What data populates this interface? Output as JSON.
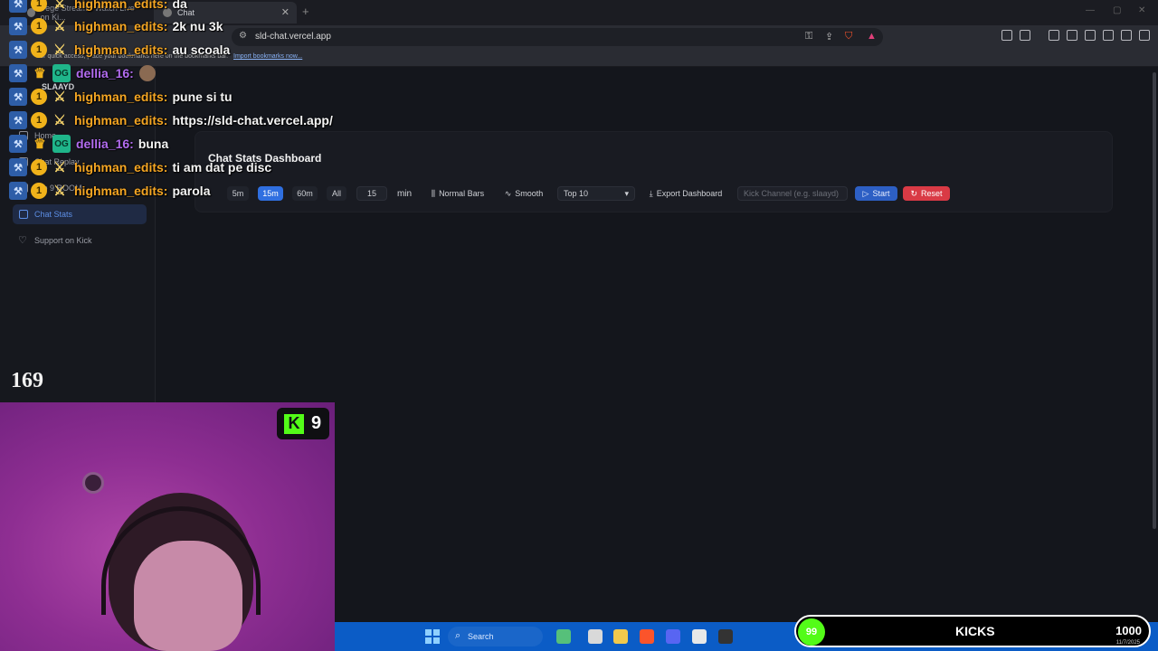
{
  "browser": {
    "tabs": [
      {
        "label": "Vege Stream - Watch Live on Ki..."
      },
      {
        "label": "Chat"
      }
    ],
    "url": "sld-chat.vercel.app",
    "bookmarks_prompt": "For quick access, place your bookmarks here on the bookmarks bar.",
    "bookmarks_link": "Import bookmarks now..."
  },
  "sidebar": {
    "brand": "SLAAYD",
    "items": [
      {
        "label": "Home"
      },
      {
        "label": "Chat Replay"
      },
      {
        "label": "Top 9 ROOM"
      },
      {
        "label": "Chat Stats"
      },
      {
        "label": "Support on Kick"
      }
    ]
  },
  "dashboard": {
    "title": "Chat Stats Dashboard",
    "ranges": [
      "5m",
      "15m",
      "60m",
      "All"
    ],
    "selected_range": "15m",
    "interval_value": "15",
    "interval_unit": "min",
    "bars_toggle": "Normal Bars",
    "smooth_toggle": "Smooth",
    "top_select": "Top 10",
    "export_label": "Export Dashboard",
    "kick_channel_placeholder": "Kick Channel (e.g. slaayd)",
    "start_label": "Start",
    "reset_label": "Reset"
  },
  "chat": [
    {
      "user": "highman_edits",
      "message": "da",
      "color": "#f5a623",
      "badges": [
        "hammer-icon",
        "sub-badge",
        "sword-icon"
      ]
    },
    {
      "user": "highman_edits",
      "message": "2k nu 3k",
      "color": "#f5a623",
      "badges": [
        "hammer-icon",
        "sub-badge",
        "sword-icon"
      ]
    },
    {
      "user": "highman_edits",
      "message": "au scoala",
      "color": "#f5a623",
      "badges": [
        "hammer-icon",
        "sub-badge",
        "sword-icon"
      ]
    },
    {
      "user": "dellia_16",
      "message": "",
      "color": "#b26cf0",
      "badges": [
        "hammer-icon",
        "crown-icon",
        "og-icon"
      ]
    },
    {
      "user": "highman_edits",
      "message": "pune si tu",
      "color": "#f5a623",
      "badges": [
        "hammer-icon",
        "sub-badge",
        "sword-icon"
      ]
    },
    {
      "user": "highman_edits",
      "message": "https://sld-chat.vercel.app/",
      "color": "#f5a623",
      "badges": [
        "hammer-icon",
        "sub-badge",
        "sword-icon"
      ]
    },
    {
      "user": "dellia_16",
      "message": "buna",
      "color": "#b26cf0",
      "badges": [
        "hammer-icon",
        "crown-icon",
        "og-icon"
      ]
    },
    {
      "user": "highman_edits",
      "message": "ti am dat pe disc",
      "color": "#f5a623",
      "badges": [
        "hammer-icon",
        "sub-badge",
        "sword-icon"
      ]
    },
    {
      "user": "highman_edits",
      "message": "parola",
      "color": "#f5a623",
      "badges": [
        "hammer-icon",
        "sub-badge",
        "sword-icon"
      ]
    }
  ],
  "badge_sub_number": "1",
  "overlay": {
    "viewer_count": "169",
    "kick_count": "9"
  },
  "taskbar": {
    "search_label": "Search"
  },
  "goal": {
    "current": "99",
    "label": "KICKS",
    "target": "1000",
    "date": "11/7/2025"
  }
}
